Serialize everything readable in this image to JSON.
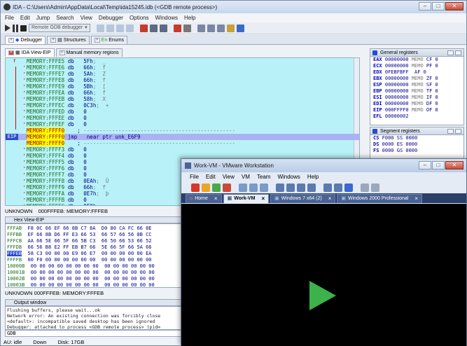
{
  "ida": {
    "title": "IDA - C:\\Users\\Admin\\AppData\\Local\\Temp\\ida15245.idb (<GDB remote process>)",
    "menu": [
      "File",
      "Edit",
      "Jump",
      "Search",
      "View",
      "Debugger",
      "Options",
      "Windows",
      "Help"
    ],
    "debugger_combo": "Remote GDB debugger",
    "tabs": [
      "Debugger",
      "Structures",
      "Enums"
    ],
    "subtabs": [
      "IDA View-EIP",
      "Manual memory regions"
    ],
    "disasm": [
      {
        "addr": "MEMORY:FFFE5",
        "ins": "db",
        "op": "5Fh",
        "cmt": ";  _"
      },
      {
        "addr": "MEMORY:FFFE6",
        "ins": "db",
        "op": "66h",
        "cmt": ";  f"
      },
      {
        "addr": "MEMORY:FFFE7",
        "ins": "db",
        "op": "5Ah",
        "cmt": ";  Z"
      },
      {
        "addr": "MEMORY:FFFE8",
        "ins": "db",
        "op": "66h",
        "cmt": ";  f"
      },
      {
        "addr": "MEMORY:FFFE9",
        "ins": "db",
        "op": "5Bh",
        "cmt": ";  ["
      },
      {
        "addr": "MEMORY:FFFEA",
        "ins": "db",
        "op": "66h",
        "cmt": ";  f"
      },
      {
        "addr": "MEMORY:FFFEB",
        "ins": "db",
        "op": "58h",
        "cmt": ";  X"
      },
      {
        "addr": "MEMORY:FFFEC",
        "ins": "db",
        "op": "0C3h",
        "cmt": ";  +"
      },
      {
        "addr": "MEMORY:FFFED",
        "ins": "db",
        "op": "0",
        "cmt": ""
      },
      {
        "addr": "MEMORY:FFFEE",
        "ins": "db",
        "op": "0",
        "cmt": ""
      },
      {
        "addr": "MEMORY:FFFEF",
        "ins": "db",
        "op": "0",
        "cmt": ""
      },
      {
        "addr": "MEMORY:FFFF0",
        "ins": "",
        "op": ";",
        "cmt": " ------------------------------------------------"
      },
      {
        "addr": "MEMORY:FFFF0",
        "ins": "jmp",
        "op": "near ptr unk_E6F9",
        "cmt": ""
      },
      {
        "addr": "MEMORY:FFFF0",
        "ins": "",
        "op": ";",
        "cmt": " ------------------------------------------------"
      },
      {
        "addr": "MEMORY:FFFF3",
        "ins": "db",
        "op": "0",
        "cmt": ""
      },
      {
        "addr": "MEMORY:FFFF4",
        "ins": "db",
        "op": "0",
        "cmt": ""
      },
      {
        "addr": "MEMORY:FFFF5",
        "ins": "db",
        "op": "0",
        "cmt": ""
      },
      {
        "addr": "MEMORY:FFFF6",
        "ins": "db",
        "op": "0",
        "cmt": ""
      },
      {
        "addr": "MEMORY:FFFF7",
        "ins": "db",
        "op": "0",
        "cmt": ""
      },
      {
        "addr": "MEMORY:FFFF8",
        "ins": "db",
        "op": "0EAh",
        "cmt": ";  Û"
      },
      {
        "addr": "MEMORY:FFFF9",
        "ins": "db",
        "op": "66h",
        "cmt": ";  f"
      },
      {
        "addr": "MEMORY:FFFFA",
        "ins": "db",
        "op": "0E7h",
        "cmt": ";  þ"
      },
      {
        "addr": "MEMORY:FFFFB",
        "ins": "db",
        "op": "0",
        "cmt": ""
      },
      {
        "addr": "MEMORY:FFFFC",
        "ins": "db",
        "op": "0F0h",
        "cmt": ";  -"
      }
    ],
    "ip_label": "EIP",
    "disasm_status": [
      "UNKNOWN",
      "000FFFEB: MEMORY:FFFEB"
    ],
    "hex_title": "Hex View-EIP",
    "hex": [
      {
        "addr": "FFFAB",
        "bytes": "F8 0C 66 EF 66 8B C7 8A  D0 80 CA FC 66 8E"
      },
      {
        "addr": "FFFBB",
        "bytes": "EF 66 8B D6 FF E3 66 53  66 57 66 56 8B CC"
      },
      {
        "addr": "FFFCB",
        "bytes": "AA 66 5E 66 5F 66 5B C3  66 50 66 53 66 52"
      },
      {
        "addr": "FFFDB",
        "bytes": "66 56 B8 E2 FF EB B7 66  5E 66 5F 66 5A 66"
      },
      {
        "addr": "FFFEB",
        "bytes": "58 C3 00 00 00 E9 06 E7  00 00 00 00 00 EA"
      },
      {
        "addr": "FFFFB",
        "bytes": "00 F0 00 00 00 00 00 00  00 00 00 00 00 00"
      },
      {
        "addr": "10000B",
        "bytes": "00 00 00 00 00 00 00 00  00 00 00 00 00 00"
      },
      {
        "addr": "10001B",
        "bytes": "00 00 00 00 00 00 00 00  00 00 00 00 00 00"
      },
      {
        "addr": "10002B",
        "bytes": "00 00 00 00 00 00 00 00  00 00 00 00 00 00"
      },
      {
        "addr": "10003B",
        "bytes": "00 00 00 00 00 00 00 00  00 00 00 00 00 00"
      }
    ],
    "hex_status": "UNKNOWN 000FFFEB: MEMORY:FFFEB",
    "output_title": "Output window",
    "output": [
      "Flushing buffers, please wait...ok",
      "Network error: An existing connection was forcibly close",
      "<default>: incompatible saved desktop has been ignored",
      "Debugger: attached to process <GDB remote process> (pid="
    ],
    "gdb_prompt": "GDB",
    "statusbar": [
      "AU: idle",
      "Down",
      "Disk: 17GB"
    ],
    "regs_title": "General registers",
    "regs": [
      {
        "n": "EAX",
        "v": "00000000",
        "f": "MEMO",
        "flag": "CF 0"
      },
      {
        "n": "ECX",
        "v": "00000000",
        "f": "MEMO",
        "flag": "PF 0"
      },
      {
        "n": "EDX",
        "v": "0FEBFBFF",
        "f": "",
        "flag": "AF 0"
      },
      {
        "n": "EBX",
        "v": "00000000",
        "f": "MEMO",
        "flag": "ZF 0"
      },
      {
        "n": "ESP",
        "v": "00000000",
        "f": "MEMO",
        "flag": "SF 0"
      },
      {
        "n": "EBP",
        "v": "00000000",
        "f": "MEMO",
        "flag": "TF 0"
      },
      {
        "n": "ESI",
        "v": "00000000",
        "f": "MEMO",
        "flag": "IF 0"
      },
      {
        "n": "EDI",
        "v": "00000000",
        "f": "MEMO",
        "flag": "DF 0"
      },
      {
        "n": "EIP",
        "v": "000FFFF0",
        "f": "MEMO",
        "flag": "OF 0"
      },
      {
        "n": "EFL",
        "v": "00000002",
        "f": "",
        "flag": ""
      }
    ],
    "seg_title": "Segment registers",
    "segs": [
      {
        "n": "CS",
        "v": "F000",
        "s": "SS 0000"
      },
      {
        "n": "DS",
        "v": "0000",
        "s": "ES 0000"
      },
      {
        "n": "FS",
        "v": "0000",
        "s": "GS 0000"
      }
    ]
  },
  "vm": {
    "title": "Work-VM - VMware Workstation",
    "menu": [
      "File",
      "Edit",
      "View",
      "VM",
      "Team",
      "Windows",
      "Help"
    ],
    "tabs": [
      "Home",
      "Work-VM",
      "Windows 7 x64 (2)",
      "Windows 2000 Professional"
    ],
    "accent": "#3bb34a"
  }
}
